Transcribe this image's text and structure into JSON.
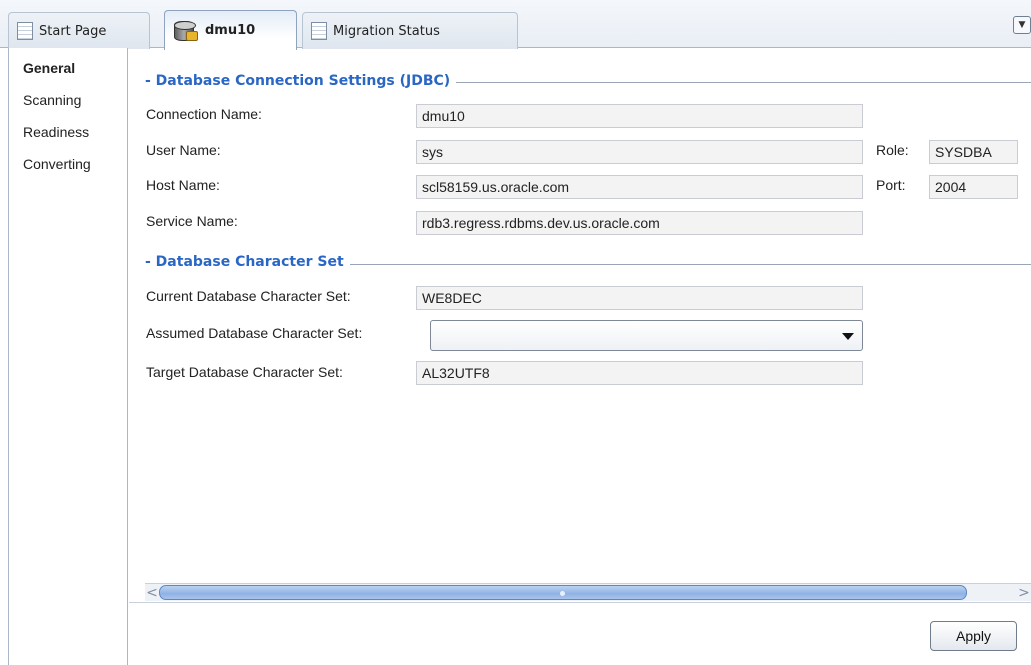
{
  "tabs": [
    {
      "label": "Start Page",
      "icon": "page-icon",
      "active": false
    },
    {
      "label": "dmu10",
      "icon": "database-icon",
      "active": true
    },
    {
      "label": "Migration Status",
      "icon": "page-icon",
      "active": false
    }
  ],
  "nav": {
    "items": [
      {
        "label": "General",
        "active": true
      },
      {
        "label": "Scanning",
        "active": false
      },
      {
        "label": "Readiness",
        "active": false
      },
      {
        "label": "Converting",
        "active": false
      }
    ]
  },
  "connection": {
    "section_title": "- Database Connection Settings (JDBC)",
    "connection_name_label": "Connection Name:",
    "connection_name_value": "dmu10",
    "user_name_label": "User Name:",
    "user_name_value": "sys",
    "role_label": "Role:",
    "role_value": "SYSDBA",
    "host_name_label": "Host Name:",
    "host_name_value": "scl58159.us.oracle.com",
    "port_label": "Port:",
    "port_value": "2004",
    "service_name_label": "Service Name:",
    "service_name_value": "rdb3.regress.rdbms.dev.us.oracle.com"
  },
  "charset": {
    "section_title": "- Database Character Set",
    "current_label": "Current Database Character Set:",
    "current_value": "WE8DEC",
    "assumed_label": "Assumed Database Character Set:",
    "assumed_value": "",
    "target_label": "Target Database Character Set:",
    "target_value": "AL32UTF8"
  },
  "buttons": {
    "apply_label": "Apply"
  },
  "colors": {
    "section_title": "#2a67c4",
    "scroll_thumb": "#8fb2e3"
  }
}
